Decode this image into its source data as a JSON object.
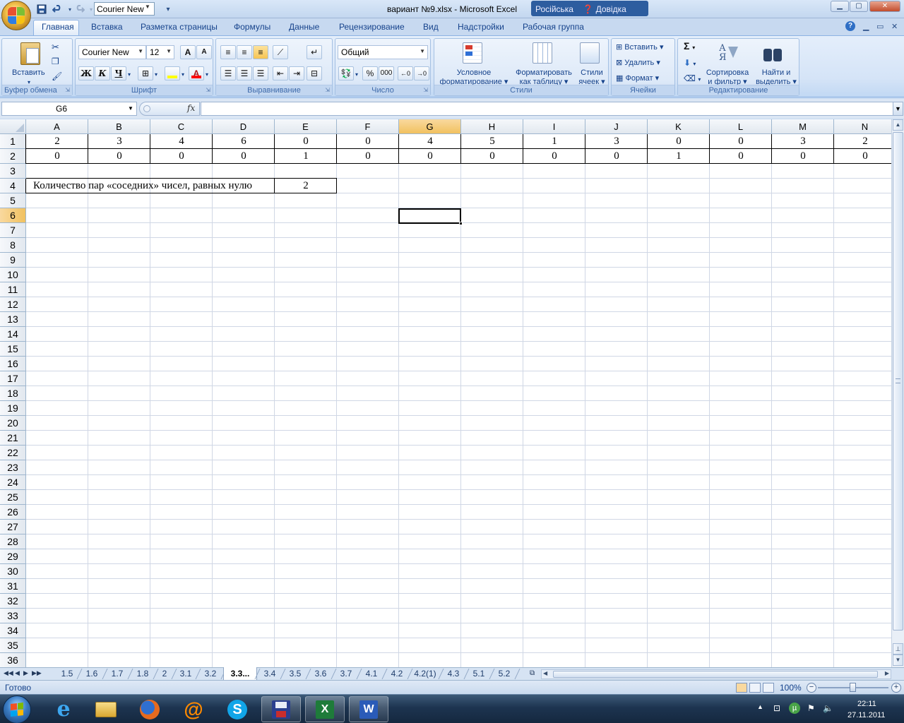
{
  "titlebar": {
    "quick_font": "Courier New",
    "title": "вариант №9.xlsx - Microsoft Excel",
    "ghost_title": "Російська",
    "ghost_help": "Довідка"
  },
  "ribbon_tabs": [
    "Главная",
    "Вставка",
    "Разметка страницы",
    "Формулы",
    "Данные",
    "Рецензирование",
    "Вид",
    "Надстройки",
    "Рабочая группа"
  ],
  "ribbon": {
    "clipboard": {
      "paste_label": "Вставить",
      "group_label": "Буфер обмена"
    },
    "font": {
      "font_name": "Courier New",
      "font_size": "12",
      "bold": "Ж",
      "italic": "К",
      "underline": "Ч",
      "grow": "A",
      "shrink": "A",
      "group_label": "Шрифт"
    },
    "alignment": {
      "group_label": "Выравнивание"
    },
    "number": {
      "format": "Общий",
      "percent": "%",
      "thousands": "000",
      "group_label": "Число"
    },
    "styles": {
      "conditional": "Условное\nформатирование",
      "as_table": "Форматировать\nкак таблицу",
      "cell_styles": "Стили\nячеек",
      "group_label": "Стили"
    },
    "cells": {
      "insert": "Вставить",
      "delete": "Удалить",
      "format": "Формат",
      "group_label": "Ячейки"
    },
    "editing": {
      "sum": "Σ",
      "sort": "Сортировка\nи фильтр",
      "find": "Найти и\nвыделить",
      "group_label": "Редактирование"
    }
  },
  "formula_bar": {
    "name_box": "G6",
    "fx": "fx",
    "formula": ""
  },
  "columns": [
    "A",
    "B",
    "C",
    "D",
    "E",
    "F",
    "G",
    "H",
    "I",
    "J",
    "K",
    "L",
    "M",
    "N"
  ],
  "rows": [
    "1",
    "2",
    "3",
    "4",
    "5",
    "6",
    "7",
    "8",
    "9",
    "10",
    "11",
    "12",
    "13",
    "14",
    "15",
    "16",
    "17",
    "18",
    "19",
    "20",
    "21",
    "22",
    "23",
    "24",
    "25",
    "26",
    "27",
    "28",
    "29",
    "30",
    "31",
    "32",
    "33",
    "34",
    "35",
    "36"
  ],
  "selected_cell": {
    "column": "G",
    "row": "6"
  },
  "cells": {
    "row1": [
      "2",
      "3",
      "4",
      "6",
      "0",
      "0",
      "4",
      "5",
      "1",
      "3",
      "0",
      "0",
      "3",
      "2"
    ],
    "row2": [
      "0",
      "0",
      "0",
      "0",
      "1",
      "0",
      "0",
      "0",
      "0",
      "0",
      "1",
      "0",
      "0",
      "0"
    ],
    "row4_label": "Количество пар «соседних» чисел, равных нулю",
    "row4_value": "2"
  },
  "sheet_tabs": [
    "1.5",
    "1.6",
    "1.7",
    "1.8",
    "2",
    "3.1",
    "3.2",
    "3.3...",
    "3.4",
    "3.5",
    "3.6",
    "3.7",
    "4.1",
    "4.2",
    "4.2(1)",
    "4.3",
    "5.1",
    "5.2"
  ],
  "active_sheet": "3.3...",
  "status": {
    "ready": "Готово",
    "zoom": "100%"
  },
  "taskbar": {
    "time": "22:11",
    "date": "27.11.2011"
  }
}
